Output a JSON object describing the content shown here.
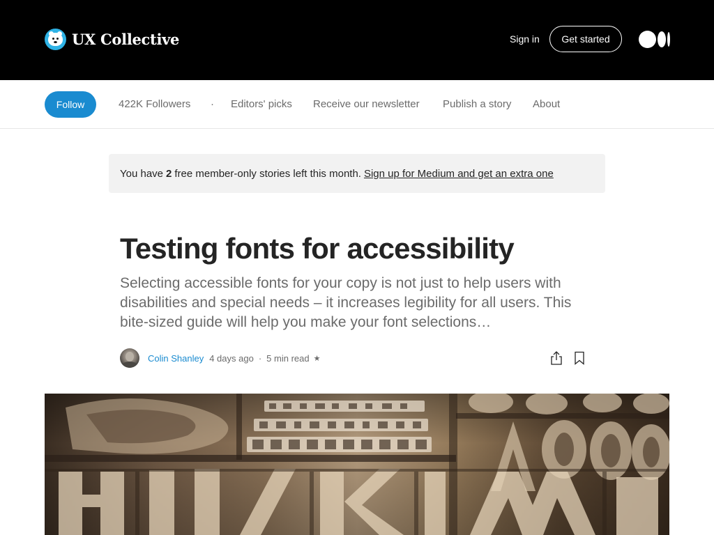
{
  "header": {
    "brand_name": "UX Collective",
    "sign_in_label": "Sign in",
    "get_started_label": "Get started"
  },
  "pubnav": {
    "follow_label": "Follow",
    "followers": "422K Followers",
    "separator": "·",
    "items": [
      "Editors' picks",
      "Receive our newsletter",
      "Publish a story",
      "About"
    ]
  },
  "banner": {
    "prefix": "You have",
    "count": "2",
    "suffix": "free member-only stories left this month.",
    "signup_link": "Sign up for Medium and get an extra one"
  },
  "article": {
    "title": "Testing fonts for accessibility",
    "subtitle": "Selecting accessible fonts for your copy is not just to help users with disabilities and special needs – it increases legibility for all users. This bite-sized guide will help you make your font selections…",
    "author": "Colin Shanley",
    "date": "4 days ago",
    "read_time": "5 min read",
    "separator": "·",
    "star": "★"
  },
  "icons": {
    "brand": "polar-bear-logo-icon",
    "medium": "medium-logo-icon",
    "share": "share-icon",
    "bookmark": "bookmark-icon"
  },
  "colors": {
    "header_bg": "#000000",
    "accent": "#1a8bd0",
    "banner_bg": "#f2f2f2",
    "text": "#242424",
    "muted": "#6b6b6b"
  }
}
